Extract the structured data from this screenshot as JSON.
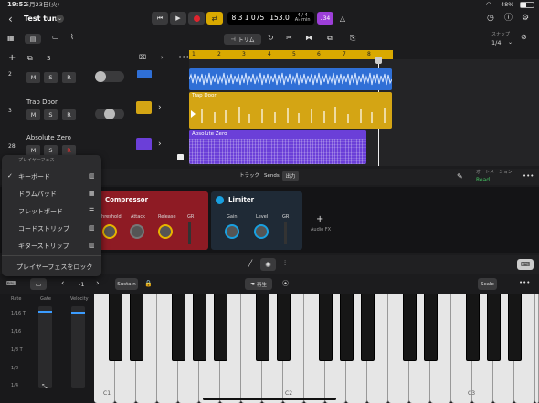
{
  "status_bar": {
    "time": "19:52",
    "date": "5月23日(火)",
    "battery": "48%"
  },
  "header": {
    "song_title": "Test tune",
    "position": "8 3 1 075",
    "tempo": "153.0",
    "time_sig": "4 / 4",
    "key": "A♭ min",
    "count_in": "♩34"
  },
  "toolbar": {
    "trim_label": "トリム",
    "snap_label": "スナップ",
    "snap_value": "1/4"
  },
  "ruler": [
    "1",
    "2",
    "3",
    "4",
    "5",
    "6",
    "7",
    "8"
  ],
  "tracks": [
    {
      "number": "2",
      "name": ""
    },
    {
      "number": "3",
      "name": "Trap Door"
    },
    {
      "number": "28",
      "name": "Absolute Zero"
    }
  ],
  "track_buttons": {
    "m": "M",
    "s": "S",
    "r": "R"
  },
  "regions": {
    "trap_door": "Trap Door",
    "absolute_zero": "Absolute Zero"
  },
  "track_header_s": "S",
  "menu": {
    "title": "プレイヤーフェス",
    "items": [
      "キーボード",
      "ドラムパッド",
      "フレットボード",
      "コードストリップ",
      "ギターストリップ"
    ],
    "lock": "プレイヤーフェスをロック"
  },
  "inspector": {
    "tabs": [
      "トラック",
      "Sends",
      "出力"
    ],
    "automation_label": "オートメーション",
    "automation_value": "Read"
  },
  "plugins": {
    "compressor": {
      "name": "Compressor",
      "knobs": [
        "Threshold",
        "Attack",
        "Release"
      ],
      "meter": "GR"
    },
    "limiter": {
      "name": "Limiter",
      "knobs": [
        "Gain",
        "Level"
      ],
      "meter": "GR"
    },
    "audio_fx": "Audio FX"
  },
  "keyboard_bar": {
    "octave": "-1",
    "sustain": "Sustain",
    "play_label": "再生",
    "scale": "Scale"
  },
  "arp": {
    "rate": "Rate",
    "gate": "Gate",
    "velocity": "Velocity",
    "rates": [
      "1/16 T",
      "1/16",
      "1/8 T",
      "1/8",
      "1/4"
    ]
  },
  "keys": {
    "c1": "C1",
    "c2": "C2",
    "c3": "C3"
  },
  "colors": {
    "blue": "#2f6fd6",
    "yellow": "#d4a514",
    "purple": "#6b3fd8",
    "red": "#8e1b24",
    "accent": "#e6b400",
    "green": "#45c463"
  }
}
